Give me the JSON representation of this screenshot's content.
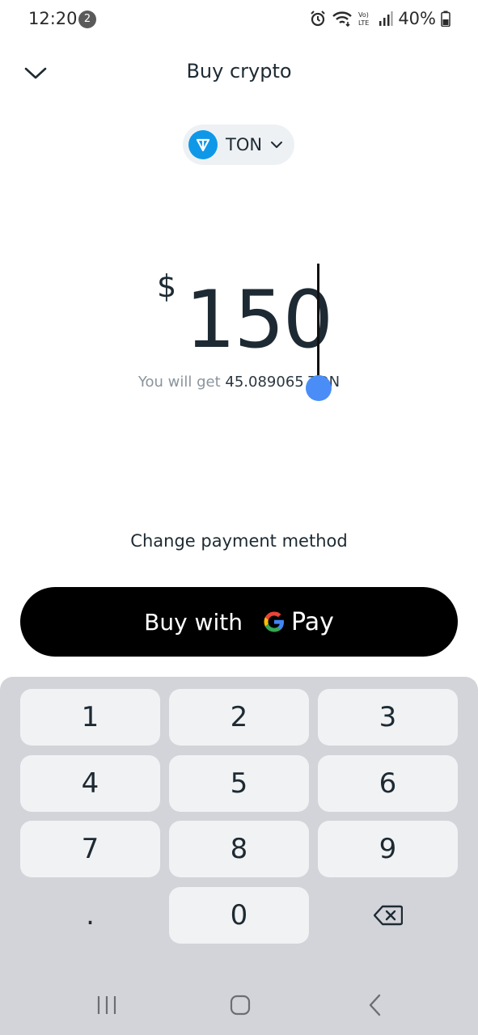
{
  "status_bar": {
    "time": "12:20",
    "notification_count": "2",
    "battery": "40%",
    "icons": [
      "alarm-icon",
      "wifi-icon",
      "volte-icon",
      "signal-icon",
      "battery-icon"
    ]
  },
  "header": {
    "close_icon": "chevron-down-icon",
    "title": "Buy crypto"
  },
  "token": {
    "icon": "ton-icon",
    "name": "TON"
  },
  "amount": {
    "currency_symbol": "$",
    "value": "150"
  },
  "receive": {
    "prefix": "You will get",
    "amount": "45.089065",
    "unit": "TON"
  },
  "change_payment_label": "Change payment method",
  "buy_button": {
    "label": "Buy with",
    "gpay_text": "Pay",
    "colors": {
      "background": "#000000",
      "text": "#ffffff"
    }
  },
  "keypad": {
    "keys": [
      "1",
      "2",
      "3",
      "4",
      "5",
      "6",
      "7",
      "8",
      "9",
      ".",
      "0"
    ],
    "backspace_icon": "backspace-icon"
  },
  "nav_bar": {
    "icons": [
      "recent-apps-icon",
      "home-icon",
      "back-icon"
    ]
  },
  "colors": {
    "ton_brand": "#0f98e8",
    "keypad_bg": "#d2d4d9",
    "key_bg": "#f0f2f4",
    "cursor_handle": "#4b8df6"
  }
}
